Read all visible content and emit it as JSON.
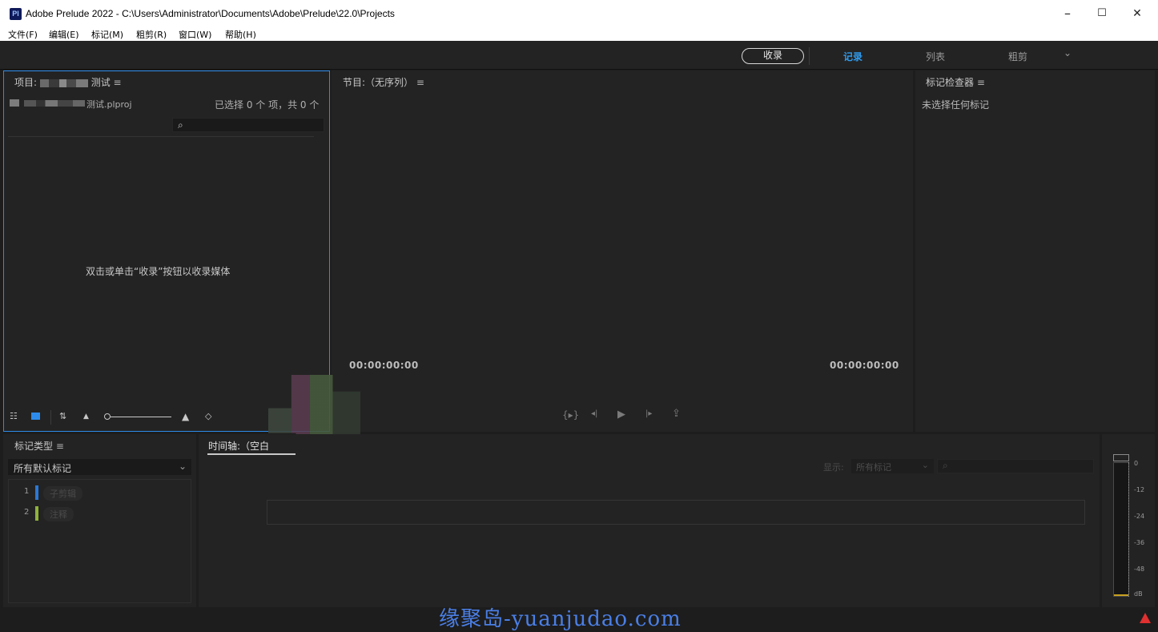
{
  "window": {
    "app_icon": "Pl",
    "title": "Adobe Prelude 2022 - C:\\Users\\Administrator\\Documents\\Adobe\\Prelude\\22.0\\Projects",
    "minimize": "–",
    "maximize": "☐",
    "close": "✕"
  },
  "menu": [
    "文件(F)",
    "编辑(E)",
    "标记(M)",
    "粗剪(R)",
    "窗口(W)",
    "帮助(H)"
  ],
  "workspaces": {
    "ingest": "收录",
    "tabs": [
      "记录",
      "列表",
      "粗剪"
    ],
    "active": "记录",
    "more_icon": "chevron-down-icon",
    "more": "⌄"
  },
  "project": {
    "title": "项目:",
    "title_suffix": "测试",
    "file_suffix": "测试.plproj",
    "selection": "已选择 0 个 项，共 0 个",
    "empty_hint": "双击或单击“收录”按钮以收录媒体"
  },
  "program": {
    "title": "节目:（无序列）",
    "tc_left": "00:00:00:00",
    "tc_right": "00:00:00:00"
  },
  "marker_inspector": {
    "title": "标记检查器",
    "empty": "未选择任何标记"
  },
  "marker_type": {
    "title": "标记类型",
    "dropdown": "所有默认标记",
    "items": [
      {
        "num": "1",
        "label": "子剪辑",
        "color": "#2a78d6"
      },
      {
        "num": "2",
        "label": "注释",
        "color": "#8fb33a"
      }
    ]
  },
  "timeline": {
    "title": "时间轴:（空白",
    "show_label": "显示:",
    "show_value": "所有标记"
  },
  "meter": {
    "ticks": [
      "0",
      "-12",
      "-24",
      "-36",
      "-48",
      "dB"
    ]
  },
  "status": {
    "warning_icon": "warning-icon"
  },
  "watermark": "缘聚岛-yuanjudao.com"
}
